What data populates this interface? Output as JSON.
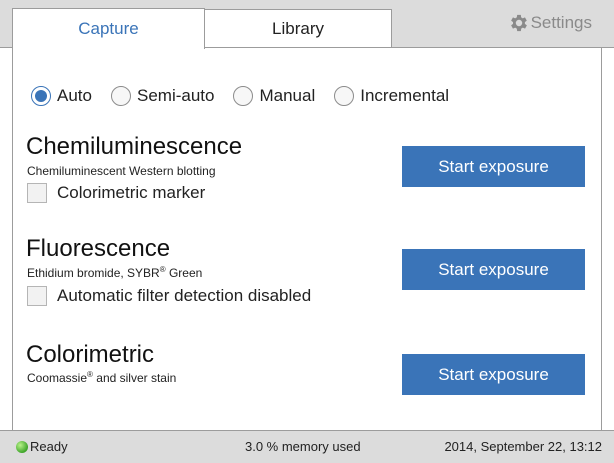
{
  "tabs": {
    "capture": "Capture",
    "library": "Library",
    "settings": "Settings"
  },
  "modes": [
    {
      "label": "Auto",
      "selected": true
    },
    {
      "label": "Semi-auto",
      "selected": false
    },
    {
      "label": "Manual",
      "selected": false
    },
    {
      "label": "Incremental",
      "selected": false
    }
  ],
  "sections": {
    "chemi": {
      "title": "Chemiluminescence",
      "subtitle": "Chemiluminescent Western blotting",
      "checkbox": "Colorimetric marker",
      "button": "Start exposure"
    },
    "fluor": {
      "title": "Fluorescence",
      "subtitle_a": "Ethidium bromide, SYBR",
      "subtitle_reg": "®",
      "subtitle_b": " Green",
      "checkbox": "Automatic filter detection disabled",
      "button": "Start exposure"
    },
    "color": {
      "title": "Colorimetric",
      "subtitle_a": "Coomassie",
      "subtitle_reg": "®",
      "subtitle_b": " and silver stain",
      "button": "Start exposure"
    }
  },
  "status": {
    "ready": "Ready",
    "memory": "3.0 % memory used",
    "datetime": "2014, September 22, 13:12"
  },
  "colors": {
    "accent": "#3a74b8",
    "status_ok": "#3fa52a"
  },
  "icons": {
    "settings": "gear-icon",
    "ready": "status-led-icon"
  }
}
